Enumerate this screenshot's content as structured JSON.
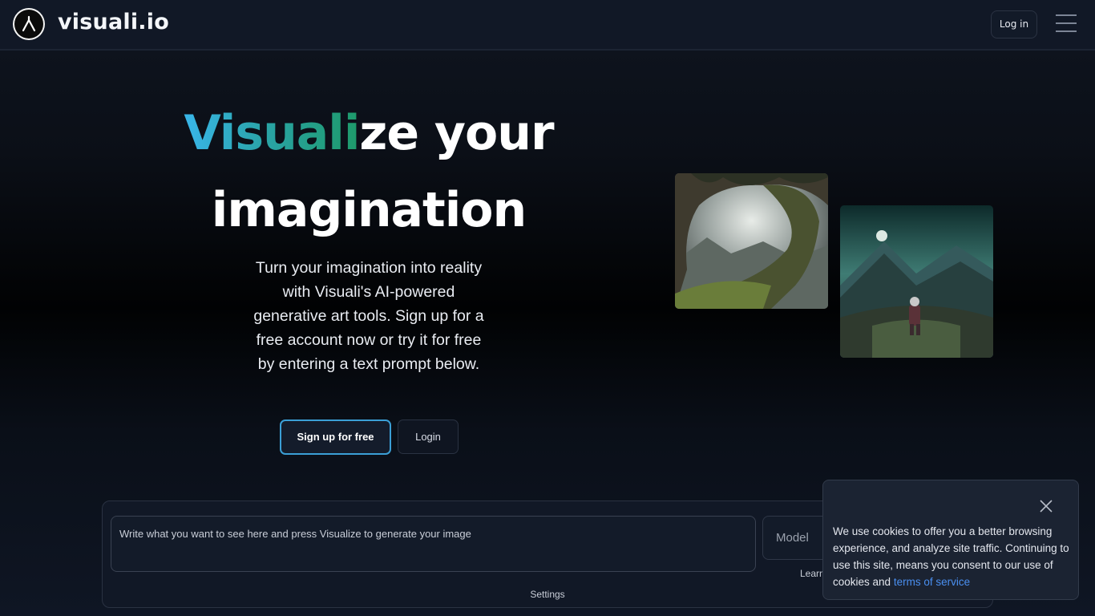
{
  "header": {
    "logo_icon": "visuali-logo-icon",
    "brand": "visuali.io",
    "login_label": "Log in",
    "menu_icon": "hamburger-menu-icon"
  },
  "hero": {
    "title_gradient": "Visuali",
    "title_rest_line1": "ze your",
    "title_line2": "imagination",
    "description": "Turn your imagination into reality with Visuali's AI-powered generative art tools. Sign up for a free account now or try it for free by entering a text prompt below.",
    "signup_label": "Sign up for free",
    "login_label": "Login"
  },
  "images": [
    {
      "name": "rock-arch-landscape-image"
    },
    {
      "name": "astronaut-mountain-moon-image"
    }
  ],
  "prompt": {
    "placeholder": "Write what you want to see here and press Visualize to generate your image",
    "model_placeholder": "Model",
    "learn_label": "Learn",
    "settings_label": "Settings"
  },
  "cookie": {
    "text": "We use cookies to offer you a better browsing experience, and analyze site traffic. Continuing to use this site, means you consent to our use of cookies and ",
    "link_text": "terms of service",
    "close_icon": "close-icon"
  },
  "colors": {
    "accent_blue": "#39b6ea",
    "accent_green": "#1e9a6a",
    "link": "#4a8ff0",
    "background": "#0b0f17"
  }
}
